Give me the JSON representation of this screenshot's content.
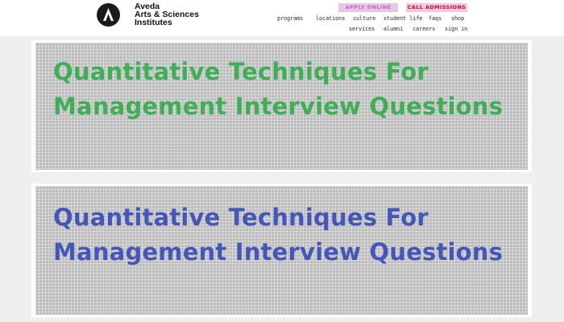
{
  "header": {
    "brand_lines": [
      "Aveda",
      "Arts & Sciences",
      "Institutes"
    ],
    "apply_label": "APPLY ONLINE",
    "call_label": "CALL ADMISSIONS",
    "nav_row1": [
      "programs",
      "locations",
      "culture",
      "student life",
      "faqs",
      "shop"
    ],
    "nav_row2": [
      "services",
      "alumni",
      "careers",
      "sign in"
    ],
    "logo_icon": "aveda-a-logo-icon"
  },
  "cards": [
    {
      "title": "Quantitative Techniques For Management Interview Questions",
      "color": "#3fae57"
    },
    {
      "title": "Quantitative Techniques For Management Interview Questions",
      "color": "#4456b8"
    }
  ]
}
